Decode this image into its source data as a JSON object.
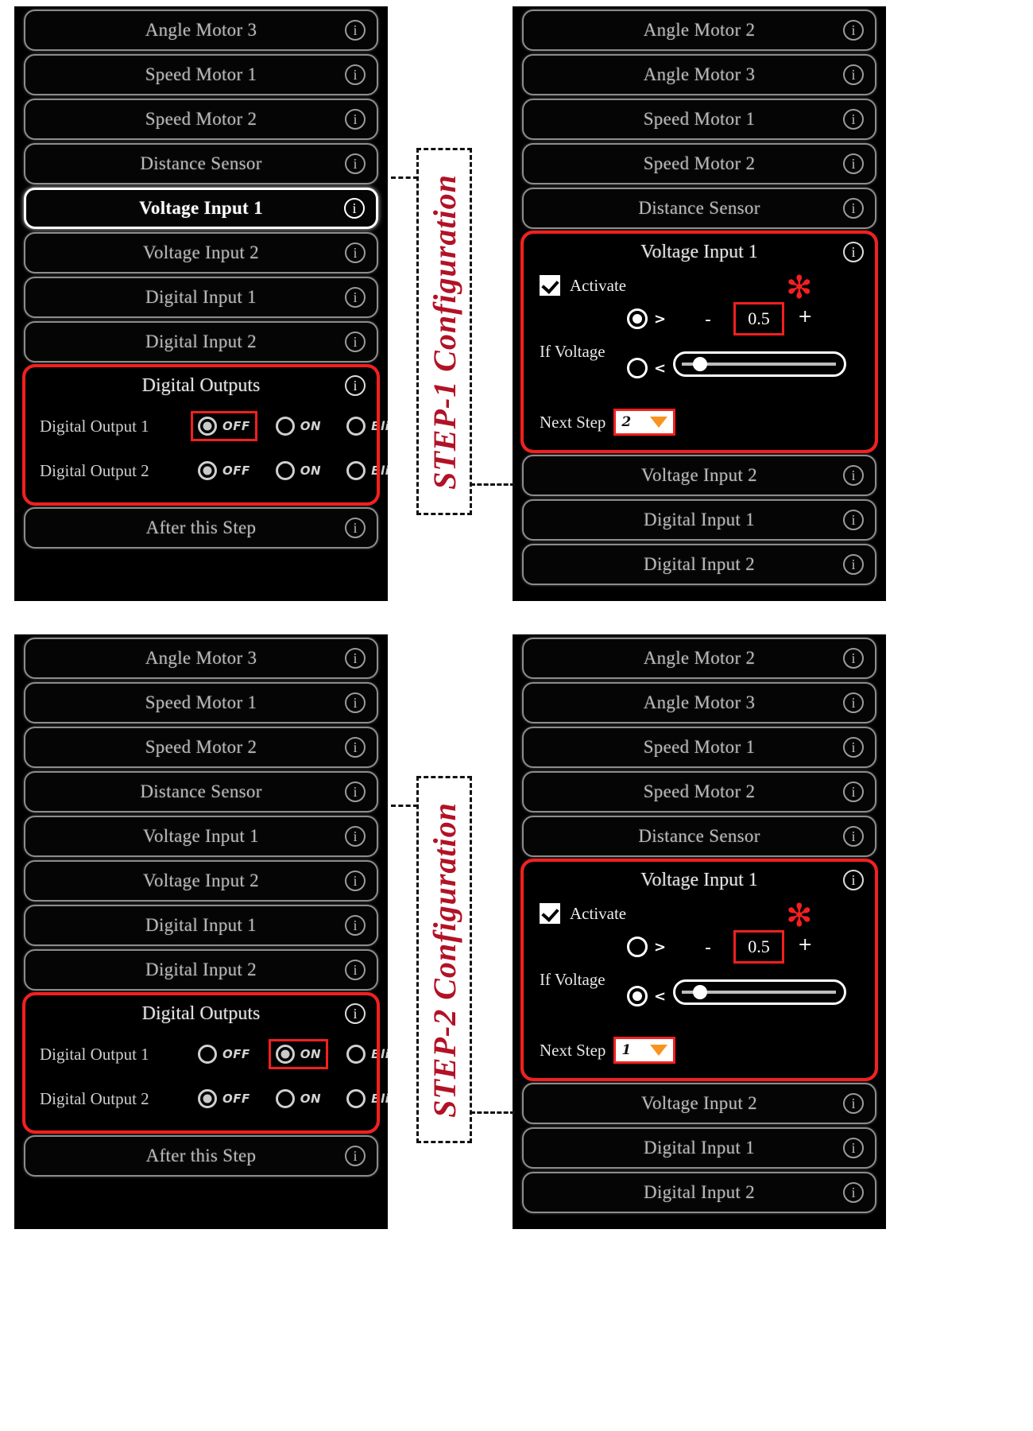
{
  "colors": {
    "highlight_red": "#f41f1f",
    "annotation_red": "#b21226",
    "caret_orange": "#f7941e",
    "screen_bg": "#000000",
    "pill_border": "#8c8c8c"
  },
  "icons": {
    "info": "i",
    "greater_than": ">",
    "less_than": "<",
    "minus": "-",
    "plus": "+",
    "asterisk": "✻",
    "caret_down": "▼"
  },
  "annotations": {
    "step1": "STEP-1 Configuration",
    "step2": "STEP-2 Configuration"
  },
  "step1": {
    "left_screen": {
      "items": [
        {
          "label": "Angle Motor 3",
          "selected": false
        },
        {
          "label": "Speed Motor 1",
          "selected": false
        },
        {
          "label": "Speed Motor 2",
          "selected": false
        },
        {
          "label": "Distance Sensor",
          "selected": false
        },
        {
          "label": "Voltage Input 1",
          "selected": true
        },
        {
          "label": "Voltage Input 2",
          "selected": false
        },
        {
          "label": "Digital Input 1",
          "selected": false
        },
        {
          "label": "Digital Input 2",
          "selected": false
        }
      ],
      "digital_outputs": {
        "title": "Digital Outputs",
        "highlighted": true,
        "rows": [
          {
            "name": "Digital Output 1",
            "options": [
              {
                "label": "OFF",
                "selected": true,
                "boxed": true
              },
              {
                "label": "ON",
                "selected": false,
                "boxed": false
              },
              {
                "label": "Blink",
                "selected": false,
                "boxed": false
              }
            ]
          },
          {
            "name": "Digital Output 2",
            "options": [
              {
                "label": "OFF",
                "selected": true,
                "boxed": false
              },
              {
                "label": "ON",
                "selected": false,
                "boxed": false
              },
              {
                "label": "Blink",
                "selected": false,
                "boxed": false
              }
            ]
          }
        ]
      },
      "footer": {
        "label": "After this Step"
      }
    },
    "right_screen": {
      "items_above": [
        {
          "label": "Angle Motor 2"
        },
        {
          "label": "Angle Motor 3"
        },
        {
          "label": "Speed Motor 1"
        },
        {
          "label": "Speed Motor 2"
        },
        {
          "label": "Distance Sensor"
        }
      ],
      "voltage_panel": {
        "title": "Voltage Input 1",
        "activate_label": "Activate",
        "activate_checked": true,
        "if_voltage_label": "If Voltage",
        "comparators": [
          {
            "symbol": ">",
            "selected": true
          },
          {
            "symbol": "<",
            "selected": false
          }
        ],
        "minus_label": "-",
        "plus_label": "+",
        "threshold_value": "0.5",
        "slider_position_pct": 12,
        "next_step_label": "Next Step",
        "next_step_value": "2"
      },
      "items_below": [
        {
          "label": "Voltage Input 2"
        },
        {
          "label": "Digital Input 1"
        },
        {
          "label": "Digital Input 2"
        }
      ]
    }
  },
  "step2": {
    "left_screen": {
      "items": [
        {
          "label": "Angle Motor 3",
          "selected": false
        },
        {
          "label": "Speed Motor 1",
          "selected": false
        },
        {
          "label": "Speed Motor 2",
          "selected": false
        },
        {
          "label": "Distance Sensor",
          "selected": false
        },
        {
          "label": "Voltage Input 1",
          "selected": false
        },
        {
          "label": "Voltage Input 2",
          "selected": false
        },
        {
          "label": "Digital Input 1",
          "selected": false
        },
        {
          "label": "Digital Input 2",
          "selected": false
        }
      ],
      "digital_outputs": {
        "title": "Digital Outputs",
        "highlighted": true,
        "rows": [
          {
            "name": "Digital Output 1",
            "options": [
              {
                "label": "OFF",
                "selected": false,
                "boxed": false
              },
              {
                "label": "ON",
                "selected": true,
                "boxed": true
              },
              {
                "label": "Blink",
                "selected": false,
                "boxed": false
              }
            ]
          },
          {
            "name": "Digital Output 2",
            "options": [
              {
                "label": "OFF",
                "selected": true,
                "boxed": false
              },
              {
                "label": "ON",
                "selected": false,
                "boxed": false
              },
              {
                "label": "Blink",
                "selected": false,
                "boxed": false
              }
            ]
          }
        ]
      },
      "footer": {
        "label": "After this Step"
      }
    },
    "right_screen": {
      "items_above": [
        {
          "label": "Angle Motor 2"
        },
        {
          "label": "Angle Motor 3"
        },
        {
          "label": "Speed Motor 1"
        },
        {
          "label": "Speed Motor 2"
        },
        {
          "label": "Distance Sensor"
        }
      ],
      "voltage_panel": {
        "title": "Voltage Input 1",
        "activate_label": "Activate",
        "activate_checked": true,
        "if_voltage_label": "If Voltage",
        "comparators": [
          {
            "symbol": ">",
            "selected": false
          },
          {
            "symbol": "<",
            "selected": true
          }
        ],
        "minus_label": "-",
        "plus_label": "+",
        "threshold_value": "0.5",
        "slider_position_pct": 12,
        "next_step_label": "Next Step",
        "next_step_value": "1"
      },
      "items_below": [
        {
          "label": "Voltage Input 2"
        },
        {
          "label": "Digital Input 1"
        },
        {
          "label": "Digital Input 2"
        }
      ]
    }
  }
}
